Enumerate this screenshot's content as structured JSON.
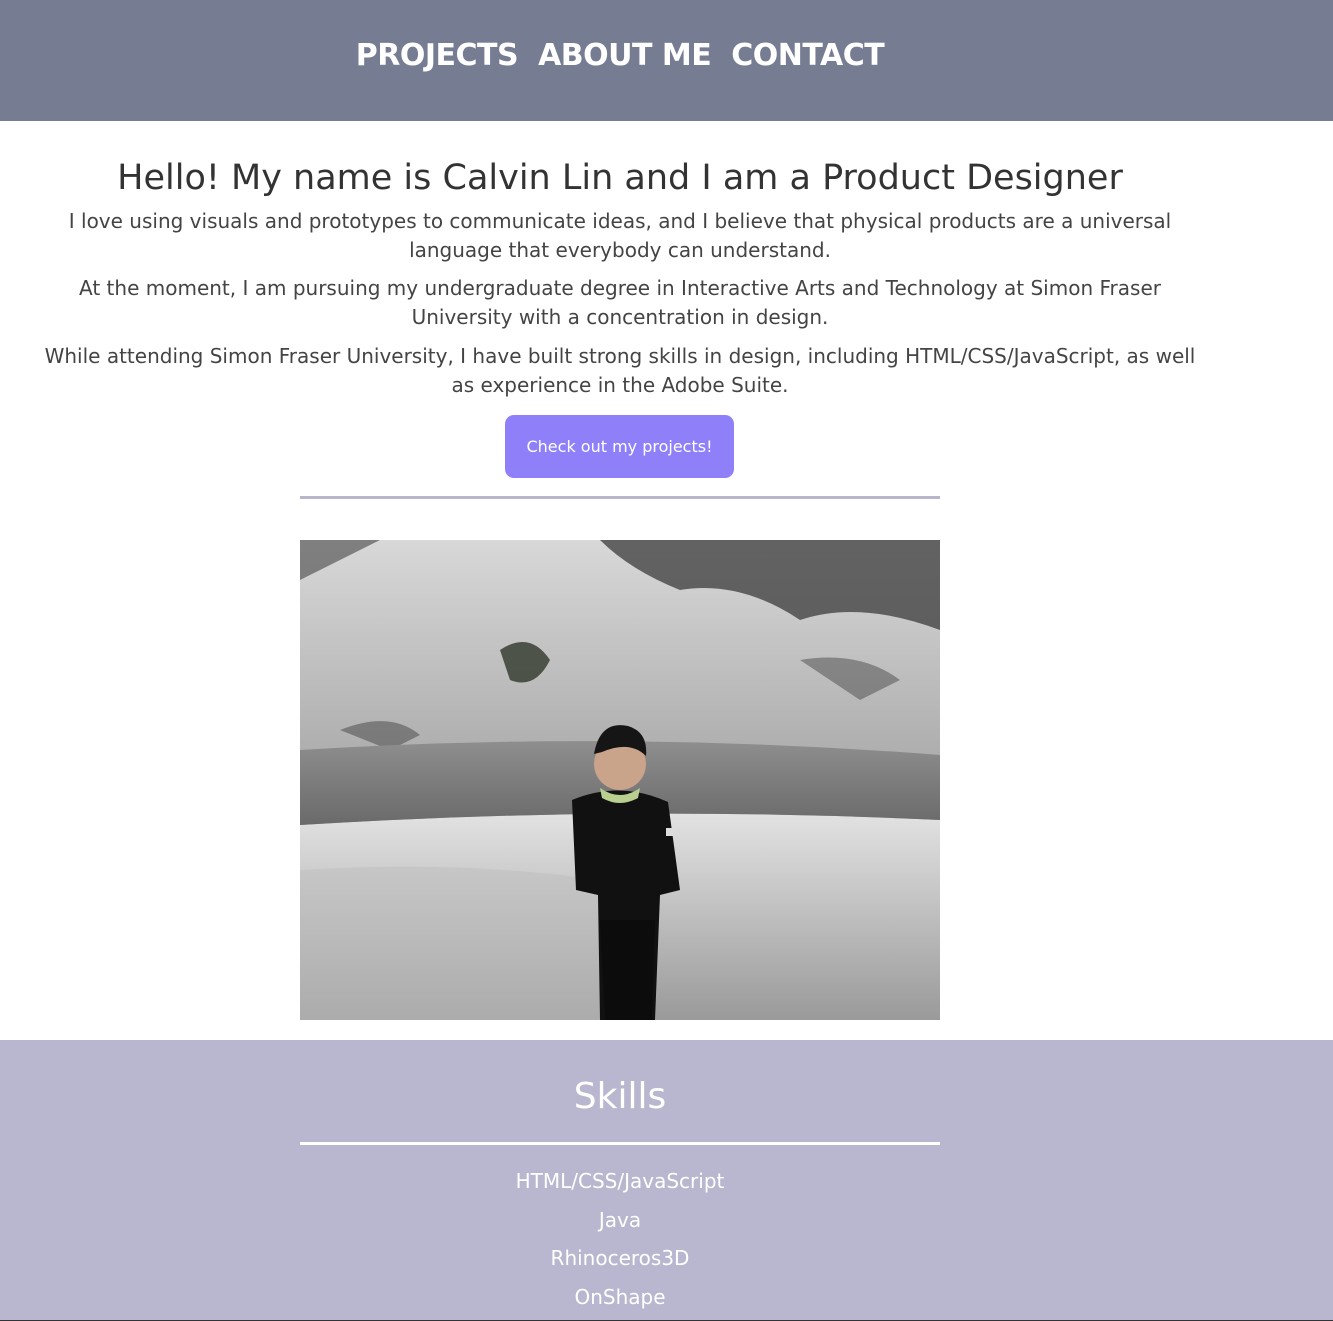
{
  "nav": {
    "links": [
      {
        "label": "PROJECTS"
      },
      {
        "label": "ABOUT ME"
      },
      {
        "label": "CONTACT"
      }
    ]
  },
  "hero": {
    "title": "Hello! My name is Calvin Lin and I am a Product Designer",
    "paragraphs": [
      "I love using visuals and prototypes to communicate ideas, and I believe that physical products are a universal language that everybody can understand.",
      "At the moment, I am pursuing my undergraduate degree in Interactive Arts and Technology at Simon Fraser University with a concentration in design.",
      "While attending Simon Fraser University, I have built strong skills in design, including HTML/CSS/JavaScript, as well as experience in the Adobe Suite."
    ],
    "cta_label": "Check out my projects!"
  },
  "skills": {
    "title": "Skills",
    "items": [
      "HTML/CSS/JavaScript",
      "Java",
      "Rhinoceros3D",
      "OnShape"
    ]
  },
  "colors": {
    "nav_bg": "#767d93",
    "cta_bg": "#8f80fa",
    "skills_bg": "#b9b6cf",
    "divider": "#b8b5cc"
  }
}
